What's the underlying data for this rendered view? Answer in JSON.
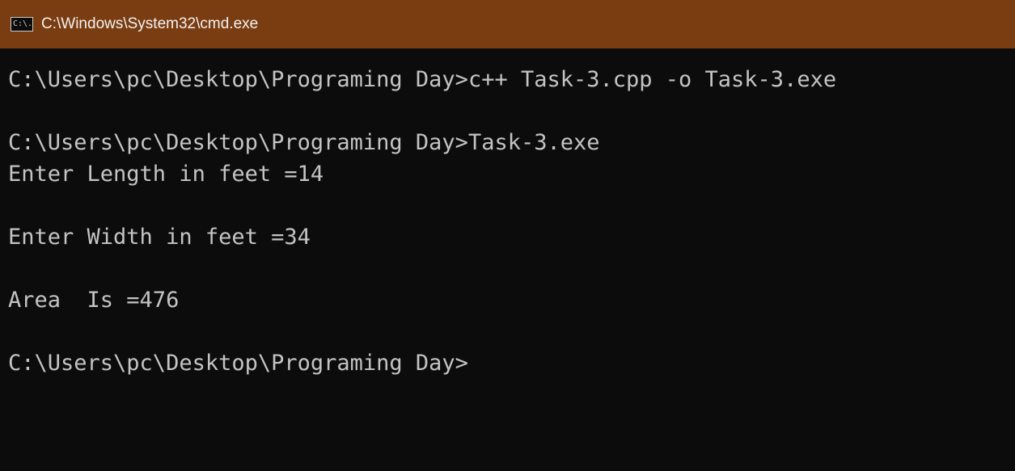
{
  "window": {
    "title": "C:\\Windows\\System32\\cmd.exe",
    "icon_label": "C:\\.",
    "icon": "cmd-console-icon"
  },
  "colors": {
    "titlebar": "#7a3d12",
    "background": "#0c0c0c",
    "text": "#c4c4c4"
  },
  "console": {
    "lines": [
      "C:\\Users\\pc\\Desktop\\Programing Day>c++ Task-3.cpp -o Task-3.exe",
      "",
      "C:\\Users\\pc\\Desktop\\Programing Day>Task-3.exe",
      "Enter Length in feet =14",
      "",
      "Enter Width in feet =34",
      "",
      "Area  Is =476",
      "",
      "C:\\Users\\pc\\Desktop\\Programing Day>"
    ]
  }
}
